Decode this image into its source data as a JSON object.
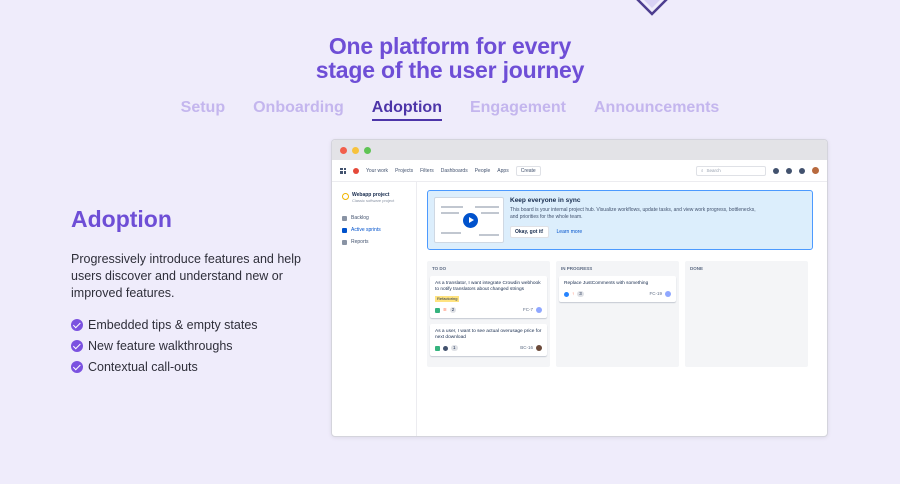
{
  "hero": {
    "title_line1": "One platform for every",
    "title_line2": "stage of the user journey"
  },
  "tabs": [
    {
      "label": "Setup",
      "active": false
    },
    {
      "label": "Onboarding",
      "active": false
    },
    {
      "label": "Adoption",
      "active": true
    },
    {
      "label": "Engagement",
      "active": false
    },
    {
      "label": "Announcements",
      "active": false
    }
  ],
  "section": {
    "heading": "Adoption",
    "description": "Progressively introduce features and help users discover and understand new or improved features.",
    "features": [
      "Embedded tips & empty states",
      "New feature walkthroughs",
      "Contextual call-outs"
    ]
  },
  "app": {
    "nav": {
      "items": [
        "Your work",
        "Projects",
        "Filters",
        "Dashboards",
        "People",
        "Apps"
      ],
      "create": "Create",
      "search_placeholder": "Search"
    },
    "sidebar": {
      "project_name": "Webapp project",
      "project_type": "Classic software project",
      "items": [
        {
          "label": "Backlog",
          "active": false
        },
        {
          "label": "Active sprints",
          "active": true
        },
        {
          "label": "Reports",
          "active": false
        }
      ]
    },
    "banner": {
      "title": "Keep everyone in sync",
      "body": "This board is your internal project hub.  Visualize workflows, update tasks, and view work progress, bottlenecks, and priorities for the whole team.",
      "ok": "Okay, got it!",
      "learn": "Learn more"
    },
    "columns": [
      {
        "title": "TO DO",
        "cards": [
          {
            "text": "As a translator, I want integrate Crowdin webhook to notify translators about changed strings",
            "tag": "Refactoring",
            "count": "2",
            "key": "FC-7"
          },
          {
            "text": "As a user, I want to see actual overusage price for next download",
            "tag": "",
            "count": "1",
            "key": "BC-16"
          }
        ]
      },
      {
        "title": "IN PROGRESS",
        "cards": [
          {
            "text": "Replace JustComments with something",
            "tag": "",
            "count": "3",
            "key": "FC-19"
          }
        ]
      },
      {
        "title": "DONE",
        "cards": []
      }
    ]
  },
  "colors": {
    "accent": "#6e4ed6",
    "tab_active": "#4d35a8",
    "tab_inactive": "#c4b6ee",
    "background": "#efecfb"
  }
}
